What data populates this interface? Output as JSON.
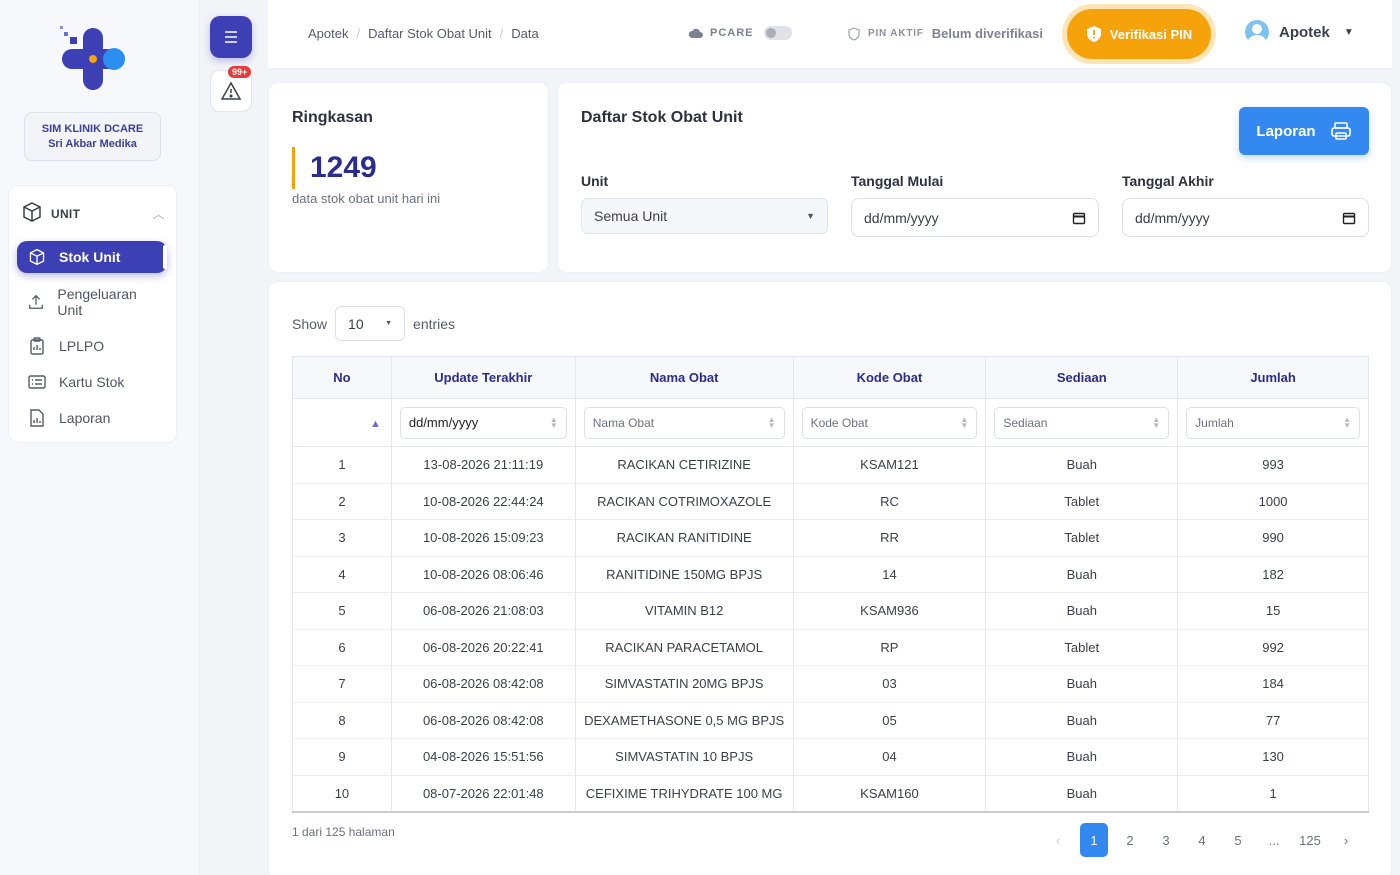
{
  "sidebar": {
    "clinic_name": "SIM KLINIK DCARE",
    "clinic_sub": "Sri Akbar Medika",
    "section_label": "UNIT",
    "items": [
      {
        "label": "Stok Unit",
        "icon": "box-icon"
      },
      {
        "label": "Pengeluaran Unit",
        "icon": "upload-icon"
      },
      {
        "label": "LPLPO",
        "icon": "clipboard-icon"
      },
      {
        "label": "Kartu Stok",
        "icon": "card-list-icon"
      },
      {
        "label": "Laporan",
        "icon": "report-icon"
      }
    ]
  },
  "rail": {
    "badge": "99+"
  },
  "header": {
    "breadcrumb": [
      "Apotek",
      "Daftar Stok Obat Unit",
      "Data"
    ],
    "pcare_label": "PCARE",
    "pin_label": "PIN AKTIF",
    "pin_value": "Belum diverifikasi",
    "verify_button": "Verifikasi PIN",
    "user_name": "Apotek"
  },
  "summary": {
    "title": "Ringkasan",
    "count": "1249",
    "description": "data stok obat unit hari ini"
  },
  "filter": {
    "title": "Daftar Stok Obat Unit",
    "report_button": "Laporan",
    "unit_label": "Unit",
    "unit_value": "Semua Unit",
    "start_label": "Tanggal Mulai",
    "start_placeholder": "dd/mm/yyyy",
    "end_label": "Tanggal Akhir",
    "end_placeholder": "dd/mm/yyyy"
  },
  "table": {
    "show_label": "Show",
    "show_value": "10",
    "entries_label": "entries",
    "columns": [
      "No",
      "Update Terakhir",
      "Nama Obat",
      "Kode Obat",
      "Sediaan",
      "Jumlah"
    ],
    "filters": [
      "dd/mm/yyyy",
      "Nama Obat",
      "Kode Obat",
      "Sediaan",
      "Jumlah"
    ],
    "rows": [
      [
        "1",
        "13-08-2026 21:11:19",
        "RACIKAN CETIRIZINE",
        "KSAM121",
        "Buah",
        "993"
      ],
      [
        "2",
        "10-08-2026 22:44:24",
        "RACIKAN COTRIMOXAZOLE",
        "RC",
        "Tablet",
        "1000"
      ],
      [
        "3",
        "10-08-2026 15:09:23",
        "RACIKAN RANITIDINE",
        "RR",
        "Tablet",
        "990"
      ],
      [
        "4",
        "10-08-2026 08:06:46",
        "RANITIDINE 150MG BPJS",
        "14",
        "Buah",
        "182"
      ],
      [
        "5",
        "06-08-2026 21:08:03",
        "VITAMIN B12",
        "KSAM936",
        "Buah",
        "15"
      ],
      [
        "6",
        "06-08-2026 20:22:41",
        "RACIKAN PARACETAMOL",
        "RP",
        "Tablet",
        "992"
      ],
      [
        "7",
        "06-08-2026 08:42:08",
        "SIMVASTATIN 20MG BPJS",
        "03",
        "Buah",
        "184"
      ],
      [
        "8",
        "06-08-2026 08:42:08",
        "DEXAMETHASONE 0,5 MG BPJS",
        "05",
        "Buah",
        "77"
      ],
      [
        "9",
        "04-08-2026 15:51:56",
        "SIMVASTATIN 10 BPJS",
        "04",
        "Buah",
        "130"
      ],
      [
        "10",
        "08-07-2026 22:01:48",
        "CEFIXIME TRIHYDRATE 100 MG",
        "KSAM160",
        "Buah",
        "1"
      ]
    ],
    "page_info": "1 dari 125 halaman",
    "pagination": [
      "‹",
      "1",
      "2",
      "3",
      "4",
      "5",
      "...",
      "125",
      "›"
    ]
  },
  "colors": {
    "primary": "#3d3fb4",
    "accent": "#f5a20b",
    "blue_button": "#3489f0"
  }
}
